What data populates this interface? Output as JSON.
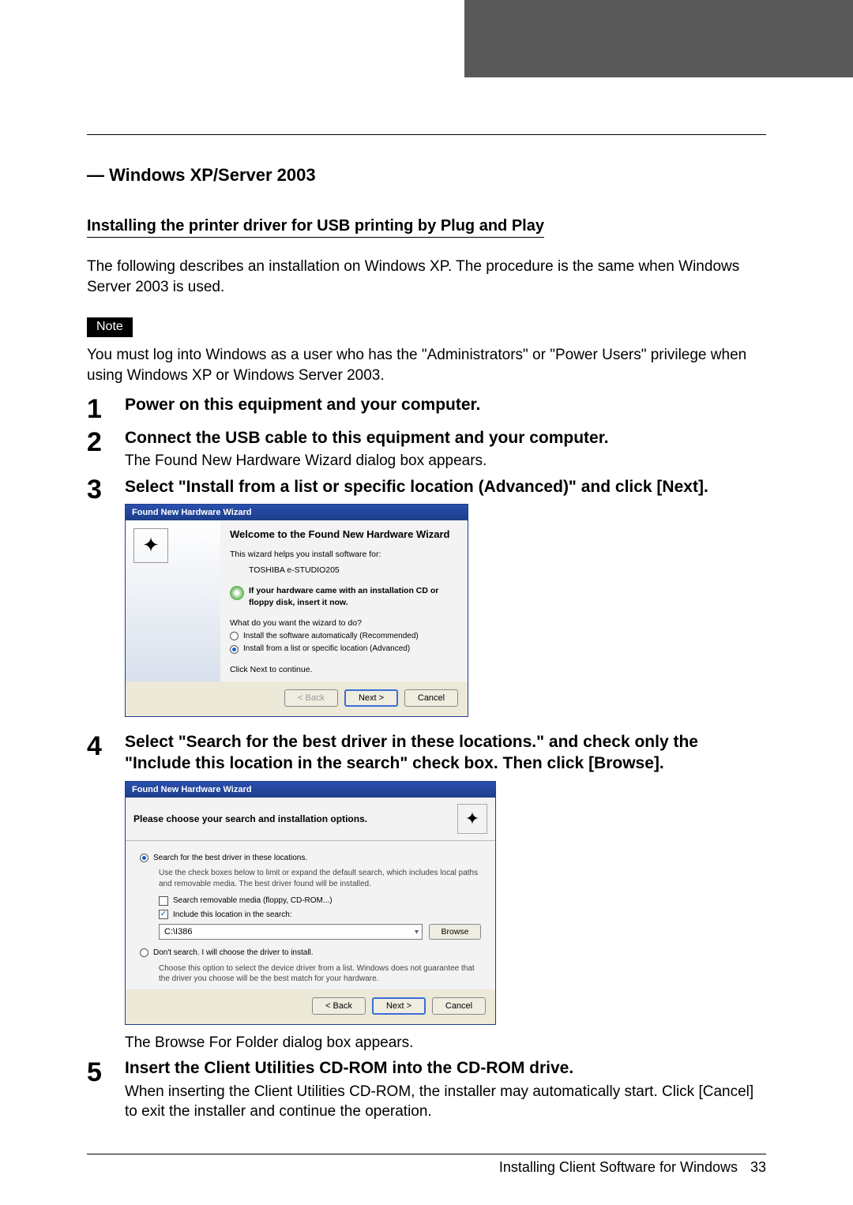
{
  "section_heading": "— Windows XP/Server 2003",
  "subsection_heading": "Installing the printer driver for USB printing by Plug and Play",
  "intro_paragraph": "The following describes an installation on Windows XP.  The procedure is the same when Windows Server 2003 is used.",
  "note_label": "Note",
  "note_paragraph": "You must log into Windows as a user who has the \"Administrators\" or \"Power Users\" privilege when using Windows XP or Windows Server 2003.",
  "steps": {
    "1": {
      "num": "1",
      "title": "Power on this equipment and your computer."
    },
    "2": {
      "num": "2",
      "title": "Connect the USB cable to this equipment and your computer.",
      "body": "The Found New Hardware Wizard dialog box appears."
    },
    "3": {
      "num": "3",
      "title": "Select \"Install from a list or specific location (Advanced)\" and click [Next]."
    },
    "4": {
      "num": "4",
      "title": "Select \"Search for the best driver in these locations.\" and check only the \"Include this location in the search\" check box.  Then click [Browse].",
      "caption": "The Browse For Folder dialog box appears."
    },
    "5": {
      "num": "5",
      "title": "Insert the Client Utilities CD-ROM into the CD-ROM drive.",
      "body": "When inserting the Client Utilities CD-ROM, the installer may automatically start. Click [Cancel] to exit the installer and continue the operation."
    }
  },
  "dialog1": {
    "window_title": "Found New Hardware Wizard",
    "heading": "Welcome to the Found New Hardware Wizard",
    "helptext": "This wizard helps you install software for:",
    "device_name": "TOSHIBA e-STUDIO205",
    "cd_hint": "If your hardware came with an installation CD or floppy disk, insert it now.",
    "question": "What do you want the wizard to do?",
    "radio_auto": "Install the software automatically (Recommended)",
    "radio_advanced": "Install from a list or specific location (Advanced)",
    "continue_text": "Click Next to continue.",
    "back": "< Back",
    "next": "Next >",
    "cancel": "Cancel"
  },
  "dialog2": {
    "window_title": "Found New Hardware Wizard",
    "heading": "Please choose your search and installation options.",
    "radio_search": "Search for the best driver in these locations.",
    "search_hint": "Use the check boxes below to limit or expand the default search, which includes local paths and removable media. The best driver found will be installed.",
    "check_removable": "Search removable media (floppy, CD-ROM...)",
    "check_include": "Include this location in the search:",
    "path_value": "C:\\I386",
    "browse_label": "Browse",
    "radio_dont": "Don't search. I will choose the driver to install.",
    "dont_hint": "Choose this option to select the device driver from a list.  Windows does not guarantee that the driver you choose will be the best match for your hardware.",
    "back": "< Back",
    "next": "Next >",
    "cancel": "Cancel"
  },
  "footer": {
    "text": "Installing Client Software for Windows",
    "page": "33"
  }
}
